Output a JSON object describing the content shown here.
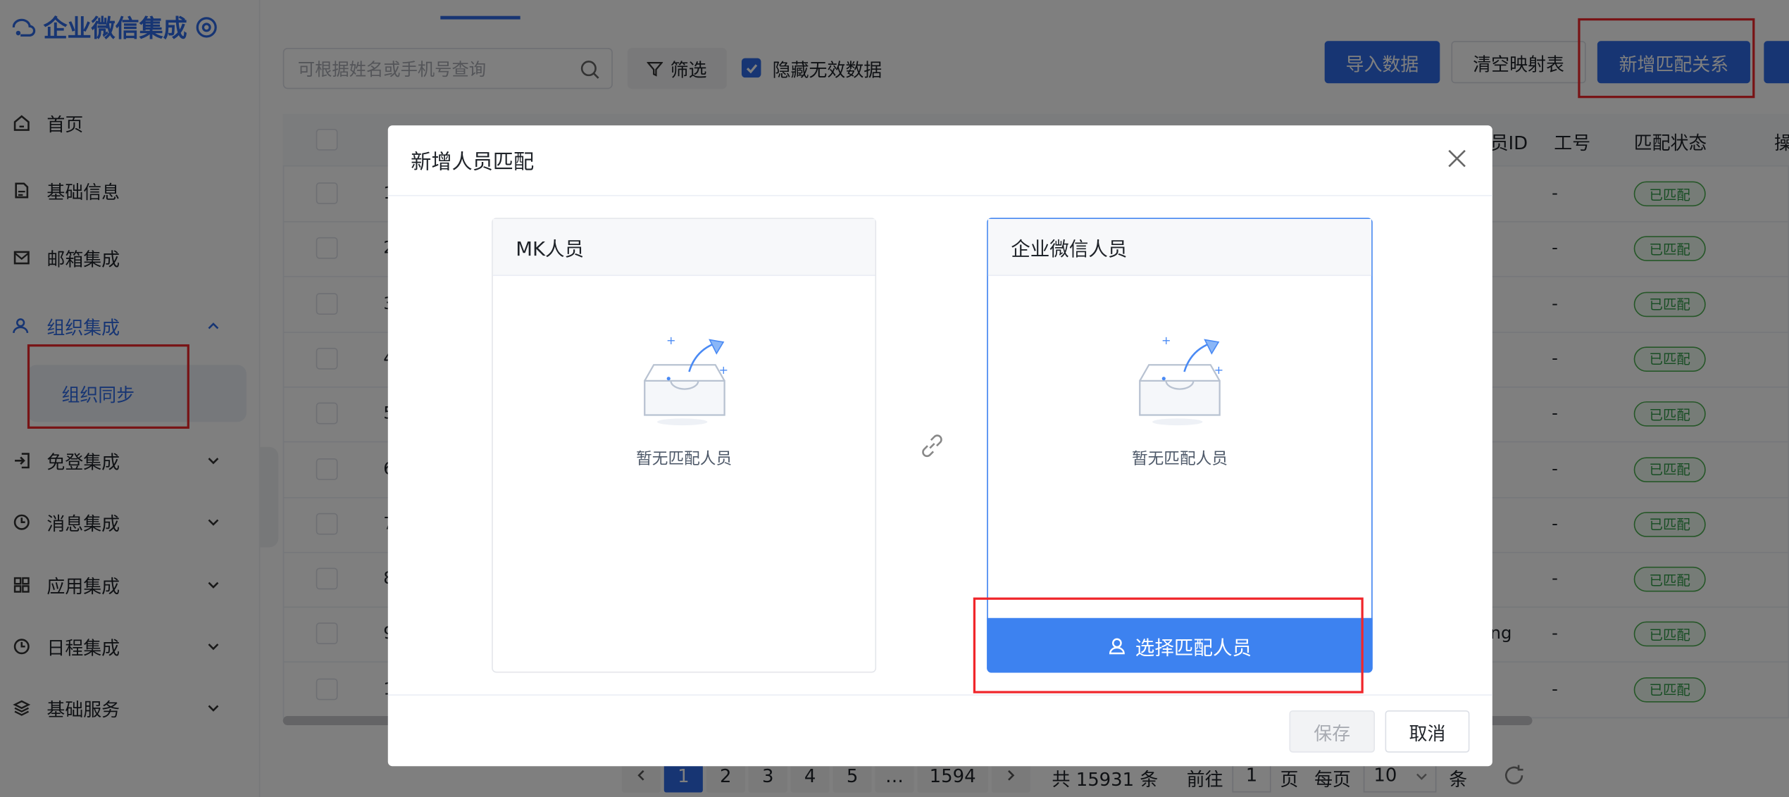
{
  "app": {
    "title": "企业微信集成"
  },
  "sidebar": {
    "items": [
      {
        "label": "首页",
        "icon": "home-icon"
      },
      {
        "label": "基础信息",
        "icon": "document-icon"
      },
      {
        "label": "邮箱集成",
        "icon": "mail-icon"
      },
      {
        "label": "组织集成",
        "icon": "org-icon",
        "expanded": true
      },
      {
        "label": "免登集成",
        "icon": "login-icon"
      },
      {
        "label": "消息集成",
        "icon": "clock-icon"
      },
      {
        "label": "应用集成",
        "icon": "apps-icon"
      },
      {
        "label": "日程集成",
        "icon": "clock-icon"
      },
      {
        "label": "基础服务",
        "icon": "layers-icon"
      }
    ],
    "sub_item": "组织同步"
  },
  "toolbar": {
    "search_placeholder": "可根据姓名或手机号查询",
    "filter_label": "筛选",
    "hide_invalid_label": "隐藏无效数据",
    "hide_invalid_checked": true,
    "import_label": "导入数据",
    "clear_label": "清空映射表",
    "add_match_label": "新增匹配关系"
  },
  "table": {
    "headers": {
      "member_id": "员ID",
      "job_no": "工号",
      "match_status": "匹配状态",
      "ops": "操"
    },
    "row_prefixes": [
      "1",
      "2",
      "3",
      "4",
      "5",
      "6",
      "7",
      "8",
      "9",
      "1"
    ],
    "job_no_values": [
      "-",
      "-",
      "-",
      "-",
      "-",
      "-",
      "-",
      "-",
      "-",
      "-"
    ],
    "status_values": [
      "已匹配",
      "已匹配",
      "已匹配",
      "已匹配",
      "已匹配",
      "已匹配",
      "已匹配",
      "已匹配",
      "已匹配",
      "已匹配"
    ],
    "row9_partial_id": "ng"
  },
  "pagination": {
    "pages": [
      "1",
      "2",
      "3",
      "4",
      "5",
      "…",
      "1594"
    ],
    "current": "1",
    "total_text": "共 15931 条",
    "goto_label": "前往",
    "goto_value": "1",
    "page_unit": "页",
    "per_page_label": "每页",
    "per_page_value": "10",
    "per_page_unit": "条"
  },
  "dialog": {
    "title": "新增人员匹配",
    "left_card_title": "MK人员",
    "right_card_title": "企业微信人员",
    "empty_text": "暂无匹配人员",
    "choose_button": "选择匹配人员",
    "save_label": "保存",
    "cancel_label": "取消"
  },
  "colors": {
    "accent": "#2e6be6",
    "highlight": "#f0262b",
    "matched": "#2e9b46"
  }
}
